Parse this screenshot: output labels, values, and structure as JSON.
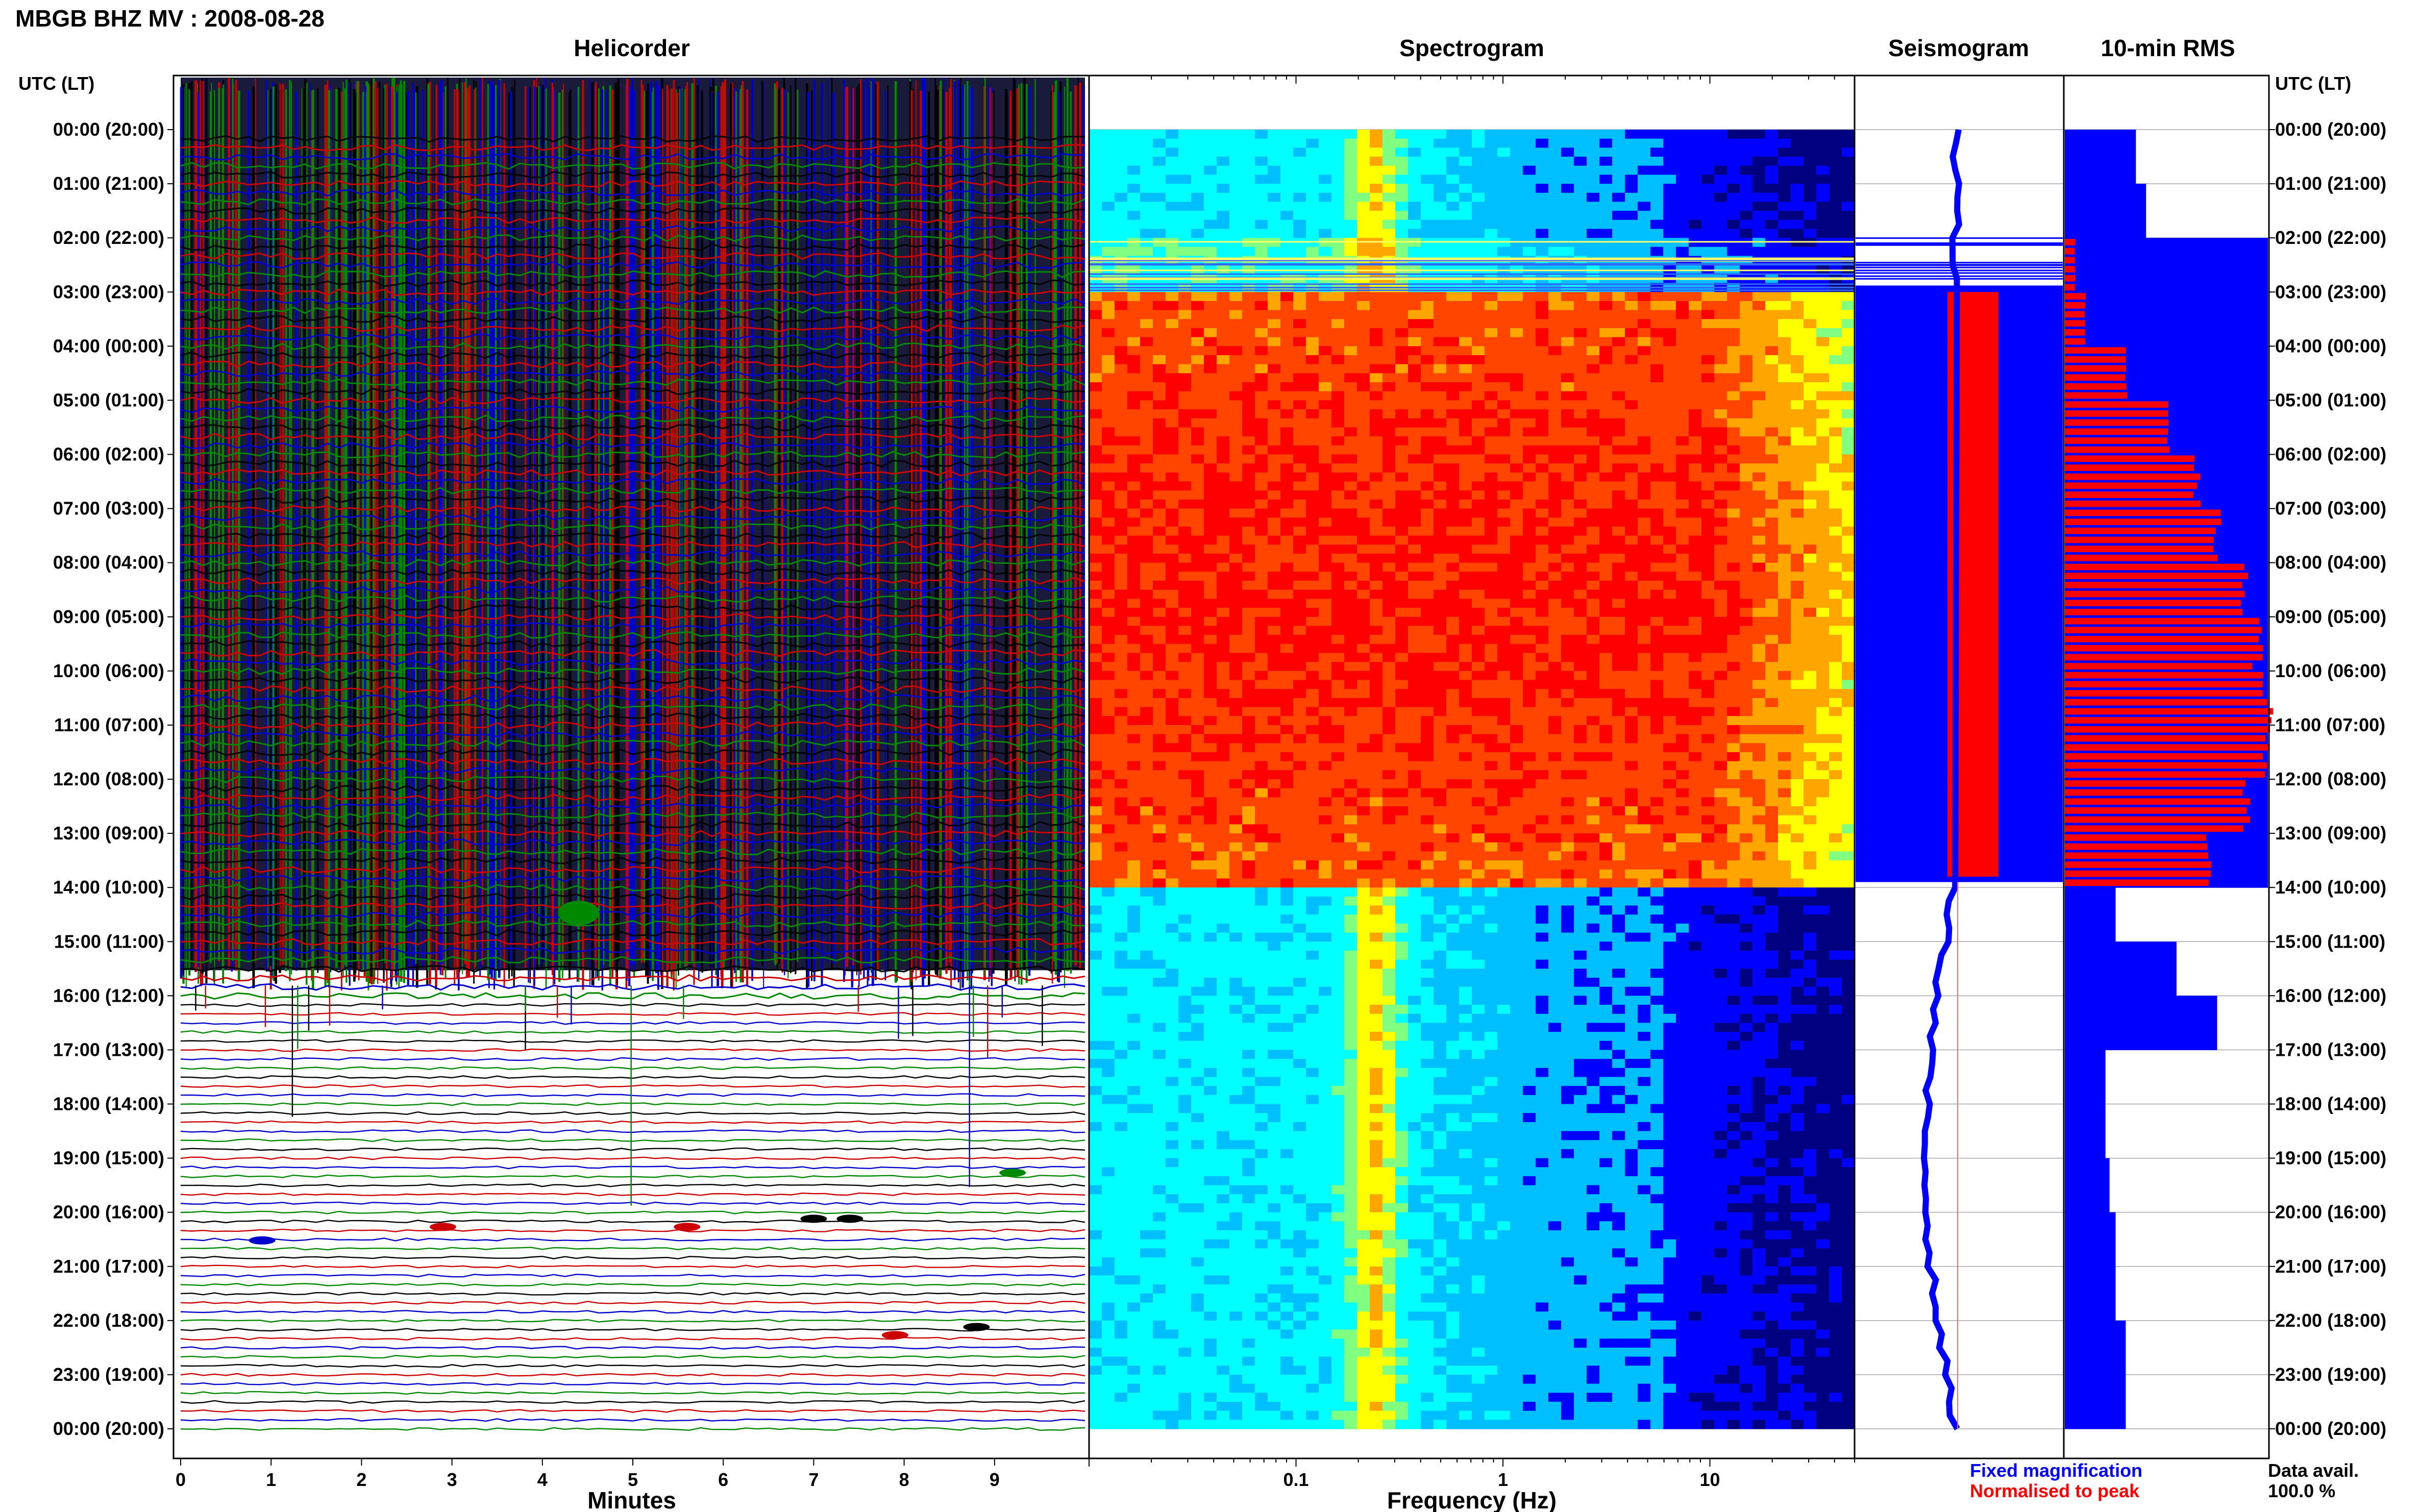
{
  "station_title": "MBGB BHZ MV : 2008-08-28",
  "panel_titles": {
    "helicorder": "Helicorder",
    "spectrogram": "Spectrogram",
    "seismogram": "Seismogram",
    "rms": "10-min RMS"
  },
  "time_axis_label": "UTC (LT)",
  "time_labels": [
    "00:00 (20:00)",
    "01:00 (21:00)",
    "02:00 (22:00)",
    "03:00 (23:00)",
    "04:00 (00:00)",
    "05:00 (01:00)",
    "06:00 (02:00)",
    "07:00 (03:00)",
    "08:00 (04:00)",
    "09:00 (05:00)",
    "10:00 (06:00)",
    "11:00 (07:00)",
    "12:00 (08:00)",
    "13:00 (09:00)",
    "14:00 (10:00)",
    "15:00 (11:00)",
    "16:00 (12:00)",
    "17:00 (13:00)",
    "18:00 (14:00)",
    "19:00 (15:00)",
    "20:00 (16:00)",
    "21:00 (17:00)",
    "22:00 (18:00)",
    "23:00 (19:00)",
    "00:00 (20:00)"
  ],
  "legend": {
    "fixed": "Fixed magnification",
    "normalised": "Normalised to peak",
    "fixed_color": "#0000ff",
    "normalised_color": "#ff0000"
  },
  "data_avail": {
    "label": "Data avail.",
    "value": "100.0 %"
  },
  "chart_data": [
    {
      "type": "line",
      "title": "Helicorder",
      "xlabel": "Minutes",
      "x_ticks": [
        "0",
        "1",
        "2",
        "3",
        "4",
        "5",
        "6",
        "7",
        "8",
        "9"
      ],
      "xlim": [
        0,
        10
      ],
      "y_range": [
        "00:00",
        "00:00 (+24h)"
      ],
      "trace_colors": [
        "#000000",
        "#cc0000",
        "#0000cc",
        "#008800"
      ],
      "saturated_until_hour": 16,
      "events": [
        {
          "hour": 14.3,
          "minute": 4.4,
          "color": "#008800"
        },
        {
          "hour": 19.1,
          "minute": 9.2,
          "color": "#008800"
        },
        {
          "hour": 19.95,
          "minute": 7.4,
          "color": "#000000"
        },
        {
          "hour": 19.95,
          "minute": 7.0,
          "color": "#000000"
        },
        {
          "hour": 20.1,
          "minute": 2.9,
          "color": "#cc0000"
        },
        {
          "hour": 20.1,
          "minute": 5.6,
          "color": "#cc0000"
        },
        {
          "hour": 20.35,
          "minute": 0.9,
          "color": "#0000cc"
        },
        {
          "hour": 21.95,
          "minute": 8.8,
          "color": "#000000"
        },
        {
          "hour": 22.1,
          "minute": 7.9,
          "color": "#cc0000"
        }
      ]
    },
    {
      "type": "heatmap",
      "title": "Spectrogram",
      "xlabel": "Frequency (Hz)",
      "x_scale": "log",
      "x_ticks": [
        "0.1",
        "1",
        "10"
      ],
      "xlim": [
        0.01,
        50
      ],
      "colormap": [
        "#000080",
        "#0000ff",
        "#00bfff",
        "#00ffff",
        "#80ff80",
        "#ffff00",
        "#ffa500",
        "#ff4500",
        "#ff0000"
      ],
      "high_energy_hours": [
        3.0,
        13.9
      ],
      "noisy_hours": [
        2.0,
        3.0
      ]
    },
    {
      "type": "line",
      "title": "Seismogram",
      "series": [
        {
          "name": "Fixed magnification",
          "color": "#0000ff"
        },
        {
          "name": "Normalised to peak",
          "color": "#ff0000"
        }
      ],
      "saturated_hours": [
        2.9,
        13.9
      ]
    },
    {
      "type": "bar",
      "title": "10-min RMS",
      "orientation": "horizontal",
      "series": [
        {
          "name": "Fixed magnification",
          "color": "#0000ff"
        },
        {
          "name": "Normalised to peak",
          "color": "#ff0000"
        }
      ],
      "fixed_magnification_hourly": [
        0.35,
        0.4,
        1.0,
        1.0,
        1.0,
        1.0,
        1.0,
        1.0,
        1.0,
        1.0,
        1.0,
        1.0,
        1.0,
        1.0,
        0.25,
        0.55,
        0.75,
        0.2,
        0.2,
        0.22,
        0.25,
        0.25,
        0.3,
        0.3
      ],
      "normalised_hourly": [
        0.0,
        0.0,
        0.05,
        0.1,
        0.3,
        0.5,
        0.65,
        0.75,
        0.88,
        0.95,
        1.0,
        1.0,
        0.9,
        0.7,
        0.0,
        0.0,
        0.0,
        0.0,
        0.0,
        0.0,
        0.0,
        0.0,
        0.0,
        0.0
      ]
    }
  ]
}
